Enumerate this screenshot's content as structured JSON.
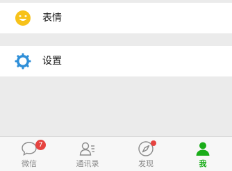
{
  "menu": {
    "emoji_label": "表情",
    "settings_label": "设置"
  },
  "tabbar": {
    "tabs": [
      {
        "label": "微信",
        "badge": "7",
        "icon": "chat-bubble-icon"
      },
      {
        "label": "通讯录",
        "icon": "contacts-icon"
      },
      {
        "label": "发现",
        "icon": "compass-icon",
        "dot": true
      },
      {
        "label": "我",
        "icon": "person-icon",
        "active": true
      }
    ]
  },
  "colors": {
    "accent": "#1aad19",
    "badge": "#e64340",
    "emoji_yellow": "#f7c21a",
    "settings_blue": "#2f8fd8"
  }
}
